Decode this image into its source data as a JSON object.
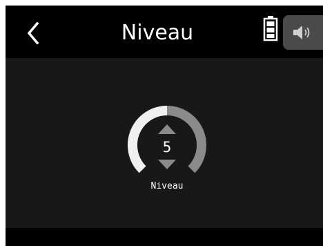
{
  "header": {
    "title": "Niveau",
    "back_icon": "chevron-left-icon",
    "battery_icon": "battery-icon",
    "speaker_icon": "speaker-icon"
  },
  "dial": {
    "value": "5",
    "label": "Niveau",
    "level_fraction": 0.5,
    "active_color": "#f0f0f0",
    "inactive_color": "#8a8a8a"
  },
  "colors": {
    "screen_background": "#181818",
    "header_background": "#000000",
    "speaker_tab": "#4a4a4a"
  }
}
